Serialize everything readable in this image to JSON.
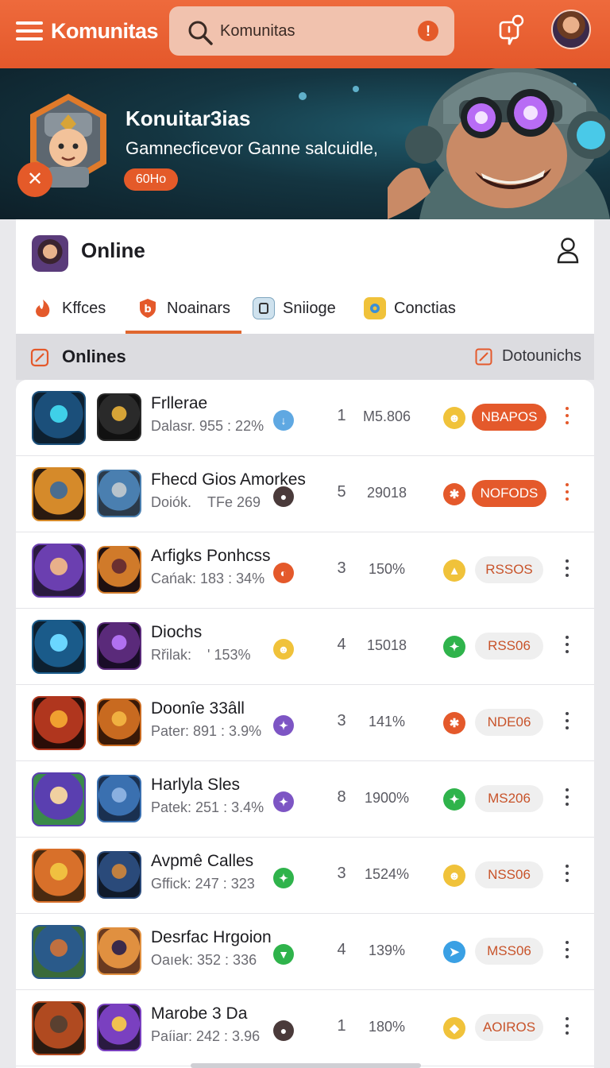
{
  "topbar": {
    "title": "Komunitas",
    "search_placeholder": "Komunitas",
    "menu_icon": "hamburger-icon",
    "search_icon": "search-icon",
    "alert_icon": "alert-icon",
    "alert_glyph": "!",
    "notification_icon": "bell-icon"
  },
  "banner": {
    "title": "Konuitar3ias",
    "subtitle": "Gamnecficevor Ganne salcuidle,",
    "badge": "60Ho",
    "close_glyph": "✕"
  },
  "online": {
    "title": "Online",
    "tabs": [
      {
        "label": "Kffces",
        "icon": "flame-icon",
        "active": false
      },
      {
        "label": "Noainars",
        "icon": "shield-icon",
        "active": true
      },
      {
        "label": "Sniioge",
        "icon": "box-icon",
        "active": false
      },
      {
        "label": "Conctias",
        "icon": "gear-icon",
        "active": false
      }
    ]
  },
  "section": {
    "title": "Onlines",
    "action": "Dotounichs"
  },
  "colors": {
    "accent": "#e4592b",
    "green": "#2fb34b",
    "blue": "#3aa0e4",
    "purple": "#7d55c4",
    "yellow": "#f0c23a"
  },
  "rows": [
    {
      "name": "Frllerae",
      "meta": "Dalasr. 955 : 22%",
      "count": "1",
      "pct": "M5.806",
      "pill": "NBAPOS",
      "pill_style": "primary",
      "status_color": "#f0c23a",
      "status_glyph": "☻",
      "meta_icon_color": "#5fa8e2",
      "meta_glyph": "↓"
    },
    {
      "name": "Fhecd Gios Amorkes",
      "meta": "Doiók.    TFe 269",
      "count": "5",
      "pct": "29018",
      "pill": "NOFODS",
      "pill_style": "primary",
      "status_color": "#e4592b",
      "status_glyph": "✱",
      "meta_icon_color": "#4a3a3a",
      "meta_glyph": "●"
    },
    {
      "name": "Arfigks Ponhcss",
      "meta": "Cańak: 183 : 34%",
      "count": "3",
      "pct": "150%",
      "pill": "RSSOS",
      "pill_style": "secondary",
      "status_color": "#f0c23a",
      "status_glyph": "▲",
      "meta_icon_color": "#e4592b",
      "meta_glyph": "◐"
    },
    {
      "name": "Diochs",
      "meta": "Rřilak:    ' 153%",
      "count": "4",
      "pct": "15018",
      "pill": "RSS06",
      "pill_style": "secondary",
      "status_color": "#2fb34b",
      "status_glyph": "✦",
      "meta_icon_color": "#f0c23a",
      "meta_glyph": "☻"
    },
    {
      "name": "Doonîe 33âll",
      "meta": "Pater: 891 : 3.9%",
      "count": "3",
      "pct": "141%",
      "pill": "NDE06",
      "pill_style": "secondary",
      "status_color": "#e4592b",
      "status_glyph": "✱",
      "meta_icon_color": "#7d55c4",
      "meta_glyph": "✦"
    },
    {
      "name": "Harlyla Sles",
      "meta": "Patek: 251 : 3.4%",
      "count": "8",
      "pct": "1900%",
      "pill": "MS206",
      "pill_style": "secondary",
      "status_color": "#2fb34b",
      "status_glyph": "✦",
      "meta_icon_color": "#7d55c4",
      "meta_glyph": "✦"
    },
    {
      "name": "Avpmê Calles",
      "meta": "Gffick: 247 : 323",
      "count": "3",
      "pct": "1524%",
      "pill": "NSS06",
      "pill_style": "secondary",
      "status_color": "#f0c23a",
      "status_glyph": "☻",
      "meta_icon_color": "#2fb34b",
      "meta_glyph": "✦"
    },
    {
      "name": "Desrfac Hrgoion",
      "meta": "Oaıek: 352 : 336",
      "count": "4",
      "pct": "139%",
      "pill": "MSS06",
      "pill_style": "secondary",
      "status_color": "#3aa0e4",
      "status_glyph": "➤",
      "meta_icon_color": "#2fb34b",
      "meta_glyph": "▼"
    },
    {
      "name": "Marobe 3 Da",
      "meta": "Paíiar: 242 : 3.96",
      "count": "1",
      "pct": "180%",
      "pill": "AOIROS",
      "pill_style": "secondary",
      "status_color": "#f0c23a",
      "status_glyph": "◆",
      "meta_icon_color": "#4a3a3a",
      "meta_glyph": "●"
    }
  ]
}
